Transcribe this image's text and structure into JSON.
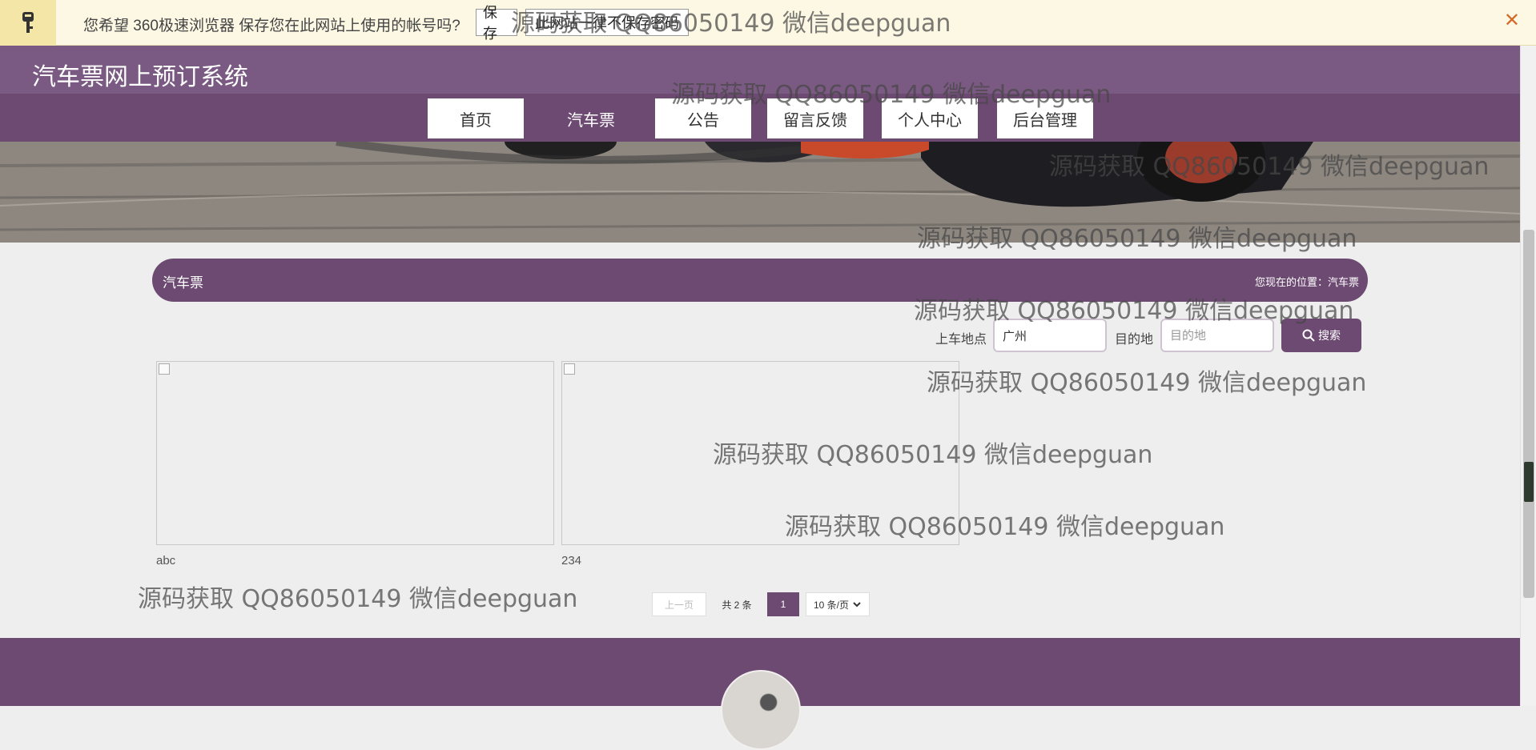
{
  "password_bar": {
    "message": "您希望 360极速浏览器 保存您在此网站上使用的帐号吗?",
    "save_label": "保存",
    "never_label": "此网站一律不保存密码",
    "close_glyph": "✕"
  },
  "header": {
    "title": "汽车票网上预订系统"
  },
  "nav": {
    "items": [
      {
        "label": "首页"
      },
      {
        "label": "汽车票"
      },
      {
        "label": "公告"
      },
      {
        "label": "留言反馈"
      },
      {
        "label": "个人中心"
      },
      {
        "label": "后台管理"
      }
    ],
    "active_index": 1
  },
  "section": {
    "title": "汽车票",
    "breadcrumb": "您现在的位置：汽车票"
  },
  "search": {
    "from_label": "上车地点",
    "from_value": "广州",
    "to_label": "目的地",
    "to_placeholder": "目的地",
    "button_label": "搜索",
    "button_icon": "search-icon"
  },
  "cards": [
    {
      "label": "abc"
    },
    {
      "label": "234"
    }
  ],
  "pagination": {
    "prev": "上一页",
    "total": "共 2 条",
    "current": "1",
    "page_size": "10 条/页"
  },
  "watermark": "源码获取 QQ86050149 微信deepguan",
  "colors": {
    "primary": "#6d4a72",
    "title_bar": "#7a5a82",
    "password_bar": "#fcf8e3",
    "page_bg": "#eeeeee"
  }
}
